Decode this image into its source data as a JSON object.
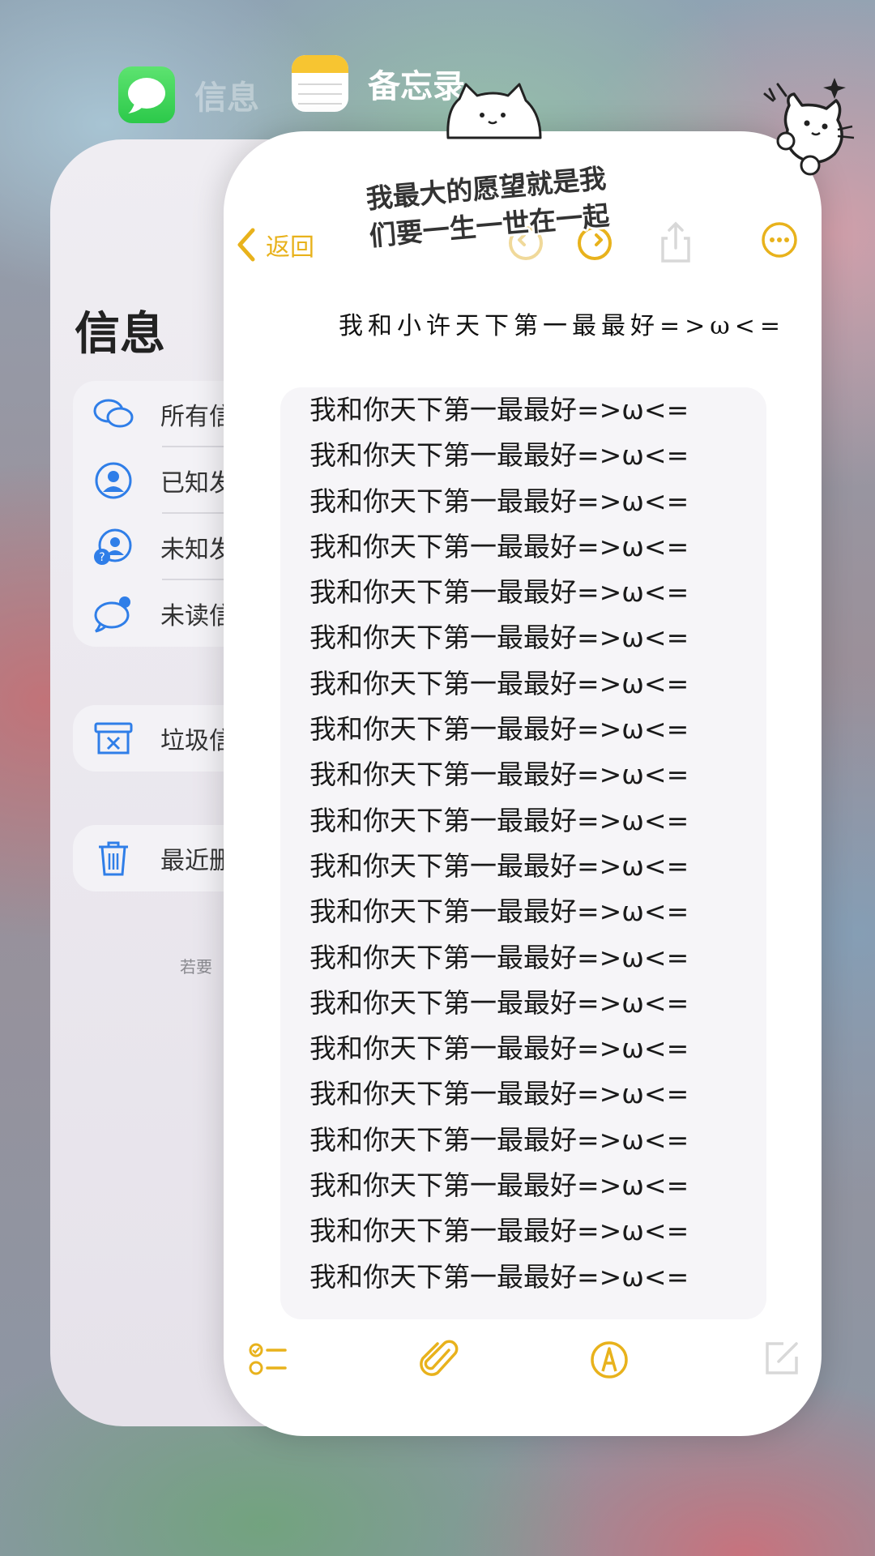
{
  "switcher": {
    "messages_app": {
      "name": "信息",
      "icon": "messages-app-icon"
    },
    "notes_app": {
      "name": "备忘录",
      "icon": "notes-app-icon"
    }
  },
  "messages_card": {
    "title": "信息",
    "filters": [
      {
        "label": "所有信",
        "icon": "all-messages-icon"
      },
      {
        "label": "已知发",
        "icon": "known-senders-icon"
      },
      {
        "label": "未知发",
        "icon": "unknown-senders-icon"
      },
      {
        "label": "未读信",
        "icon": "unread-messages-icon"
      }
    ],
    "junk": {
      "label": "垃圾信",
      "icon": "junk-icon"
    },
    "recently_deleted": {
      "label": "最近删",
      "icon": "trash-icon"
    },
    "footer": "若要"
  },
  "notes_card": {
    "back_label": "返回",
    "accent_color": "#E8B21C",
    "nav_icons": [
      "undo-icon",
      "redo-icon",
      "share-icon",
      "more-icon"
    ],
    "handwritten_line": "我和小许天下第一最最好",
    "emoticon": "=>ω<=",
    "body_lines": [
      "我和你天下第一最最好=>ω<=",
      "我和你天下第一最最好=>ω<=",
      "我和你天下第一最最好=>ω<=",
      "我和你天下第一最最好=>ω<=",
      "我和你天下第一最最好=>ω<=",
      "我和你天下第一最最好=>ω<=",
      "我和你天下第一最最好=>ω<=",
      "我和你天下第一最最好=>ω<=",
      "我和你天下第一最最好=>ω<=",
      "我和你天下第一最最好=>ω<=",
      "我和你天下第一最最好=>ω<=",
      "我和你天下第一最最好=>ω<=",
      "我和你天下第一最最好=>ω<=",
      "我和你天下第一最最好=>ω<=",
      "我和你天下第一最最好=>ω<=",
      "我和你天下第一最最好=>ω<=",
      "我和你天下第一最最好=>ω<=",
      "我和你天下第一最最好=>ω<=",
      "我和你天下第一最最好=>ω<=",
      "我和你天下第一最最好=>ω<="
    ],
    "toolbar_icons": [
      "checklist-icon",
      "attachment-icon",
      "markup-icon",
      "compose-icon"
    ]
  },
  "overlay": {
    "caption_line1": "我最大的愿望就是我",
    "caption_line2": "们要一生一世在一起",
    "stickers": [
      "cat-sticker-icon",
      "peeking-cat-sticker-icon"
    ]
  }
}
